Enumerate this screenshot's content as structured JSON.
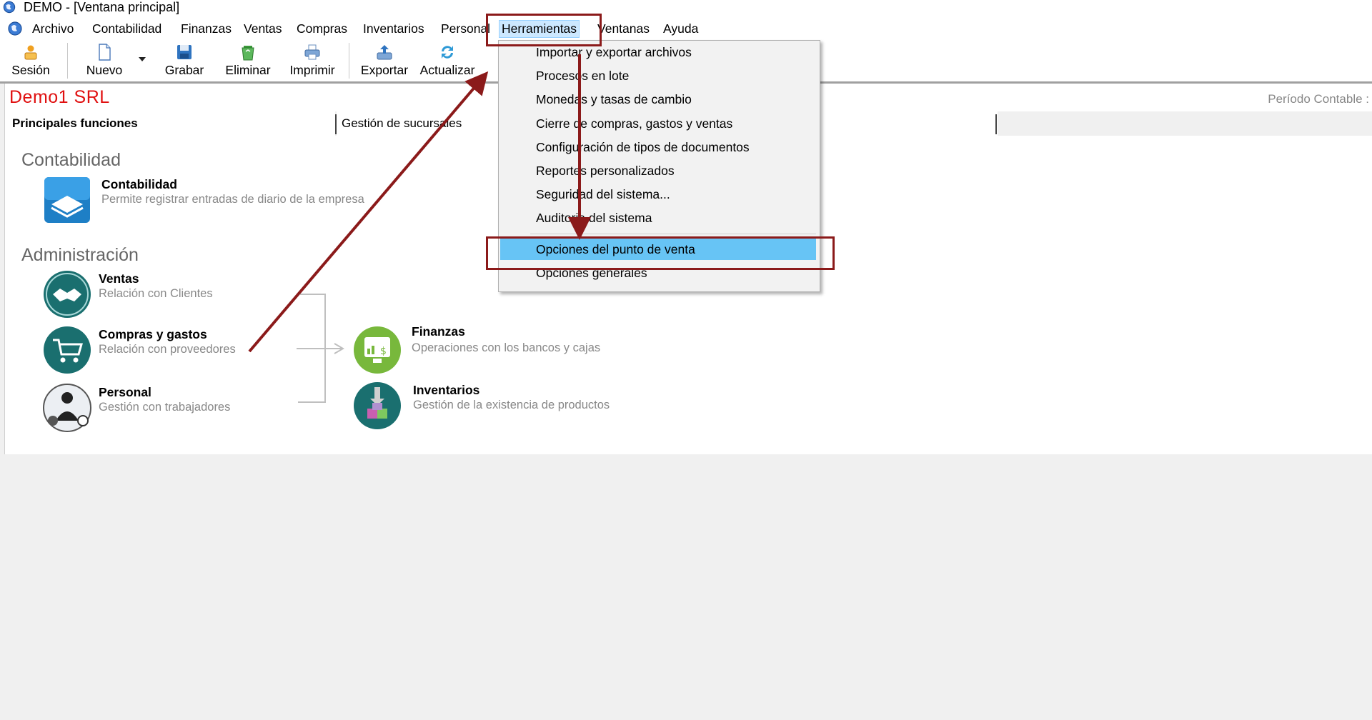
{
  "window": {
    "title": "DEMO - [Ventana principal]"
  },
  "menubar": {
    "items": [
      "Archivo",
      "Contabilidad",
      "Finanzas",
      "Ventas",
      "Compras",
      "Inventarios",
      "Personal",
      "Herramientas",
      "Ventanas",
      "Ayuda"
    ],
    "active": "Herramientas"
  },
  "toolbar": {
    "session": "Sesión",
    "new": "Nuevo",
    "save": "Grabar",
    "delete": "Eliminar",
    "print": "Imprimir",
    "export": "Exportar",
    "refresh": "Actualizar"
  },
  "company": {
    "name": "Demo1 SRL",
    "period_label": "Período Contable :"
  },
  "tabs": [
    "Principales funciones",
    "Gestión de sucursales"
  ],
  "sections": {
    "contabilidad": {
      "title": "Contabilidad",
      "items": [
        {
          "name": "Contabilidad",
          "desc": "Permite registrar entradas de diario de la empresa"
        }
      ]
    },
    "administracion": {
      "title": "Administración",
      "items": [
        {
          "name": "Ventas",
          "desc": "Relación con Clientes"
        },
        {
          "name": "Compras y gastos",
          "desc": "Relación con proveedores"
        },
        {
          "name": "Personal",
          "desc": "Gestión con trabajadores"
        },
        {
          "name": "Finanzas",
          "desc": "Operaciones con los bancos y cajas"
        },
        {
          "name": "Inventarios",
          "desc": "Gestión de la existencia de productos"
        }
      ]
    }
  },
  "dropdown": {
    "items": [
      "Importar y exportar archivos",
      "Procesos en lote",
      "Monedas y tasas de cambio",
      "Cierre de compras, gastos y ventas",
      "Configuración de tipos de documentos",
      "Reportes personalizados",
      "Seguridad del sistema...",
      "Auditoria del sistema",
      "Opciones del punto de venta",
      "Opciones generales"
    ],
    "highlighted": "Opciones del punto de venta"
  },
  "colors": {
    "company_red": "#e01010",
    "callout": "#8b1a1a",
    "menu_highlight": "#67c4f5",
    "teal": "#1a6f6f"
  }
}
